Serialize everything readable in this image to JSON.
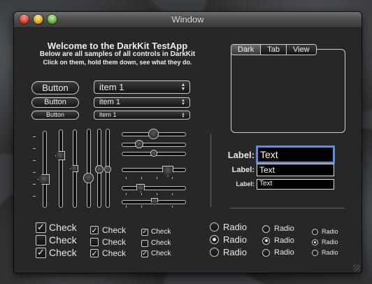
{
  "window": {
    "title": "Window"
  },
  "header": {
    "title": "Welcome to the DarkKit TestApp",
    "subtitle": "Below are all samples of all controls in DarkKit",
    "hint": "Click on them, hold them down, see what they do."
  },
  "buttons": {
    "large": "Button",
    "medium": "Button",
    "small": "Button"
  },
  "popups": {
    "large": "item 1",
    "medium": "item 1",
    "small": "item 1"
  },
  "tabs": [
    {
      "label": "Dark"
    },
    {
      "label": "Tab"
    },
    {
      "label": "View"
    }
  ],
  "textfields": [
    {
      "label": "Label:",
      "value": "Text"
    },
    {
      "label": "Label:",
      "value": "Text"
    },
    {
      "label": "Label:",
      "value": "Text"
    }
  ],
  "checkboxes": {
    "large": [
      {
        "label": "Check",
        "checked": true
      },
      {
        "label": "Check",
        "checked": false
      },
      {
        "label": "Check",
        "checked": true
      }
    ],
    "medium": [
      {
        "label": "Check",
        "checked": true
      },
      {
        "label": "Check",
        "checked": false
      },
      {
        "label": "Check",
        "checked": true
      }
    ],
    "small": [
      {
        "label": "Check",
        "checked": true
      },
      {
        "label": "Check",
        "checked": false
      },
      {
        "label": "Check",
        "checked": true
      }
    ]
  },
  "radios": {
    "large": [
      {
        "label": "Radio",
        "selected": false
      },
      {
        "label": "Radio",
        "selected": true
      },
      {
        "label": "Radio",
        "selected": false
      }
    ],
    "medium": [
      {
        "label": "Radio",
        "selected": false
      },
      {
        "label": "Radio",
        "selected": true
      },
      {
        "label": "Radio",
        "selected": false
      }
    ],
    "small": [
      {
        "label": "Radio",
        "selected": false
      },
      {
        "label": "Radio",
        "selected": true
      },
      {
        "label": "Radio",
        "selected": false
      }
    ]
  },
  "sliders": {
    "vertical": [
      0.5,
      0.55,
      0.42,
      0.4,
      0.45,
      0.45
    ],
    "horizontal": [
      0.6,
      0.2,
      0.35,
      0.7,
      0.2,
      0.5
    ]
  },
  "colors": {
    "focus_ring": "#5f8ccc",
    "window_bg": "#272727"
  }
}
